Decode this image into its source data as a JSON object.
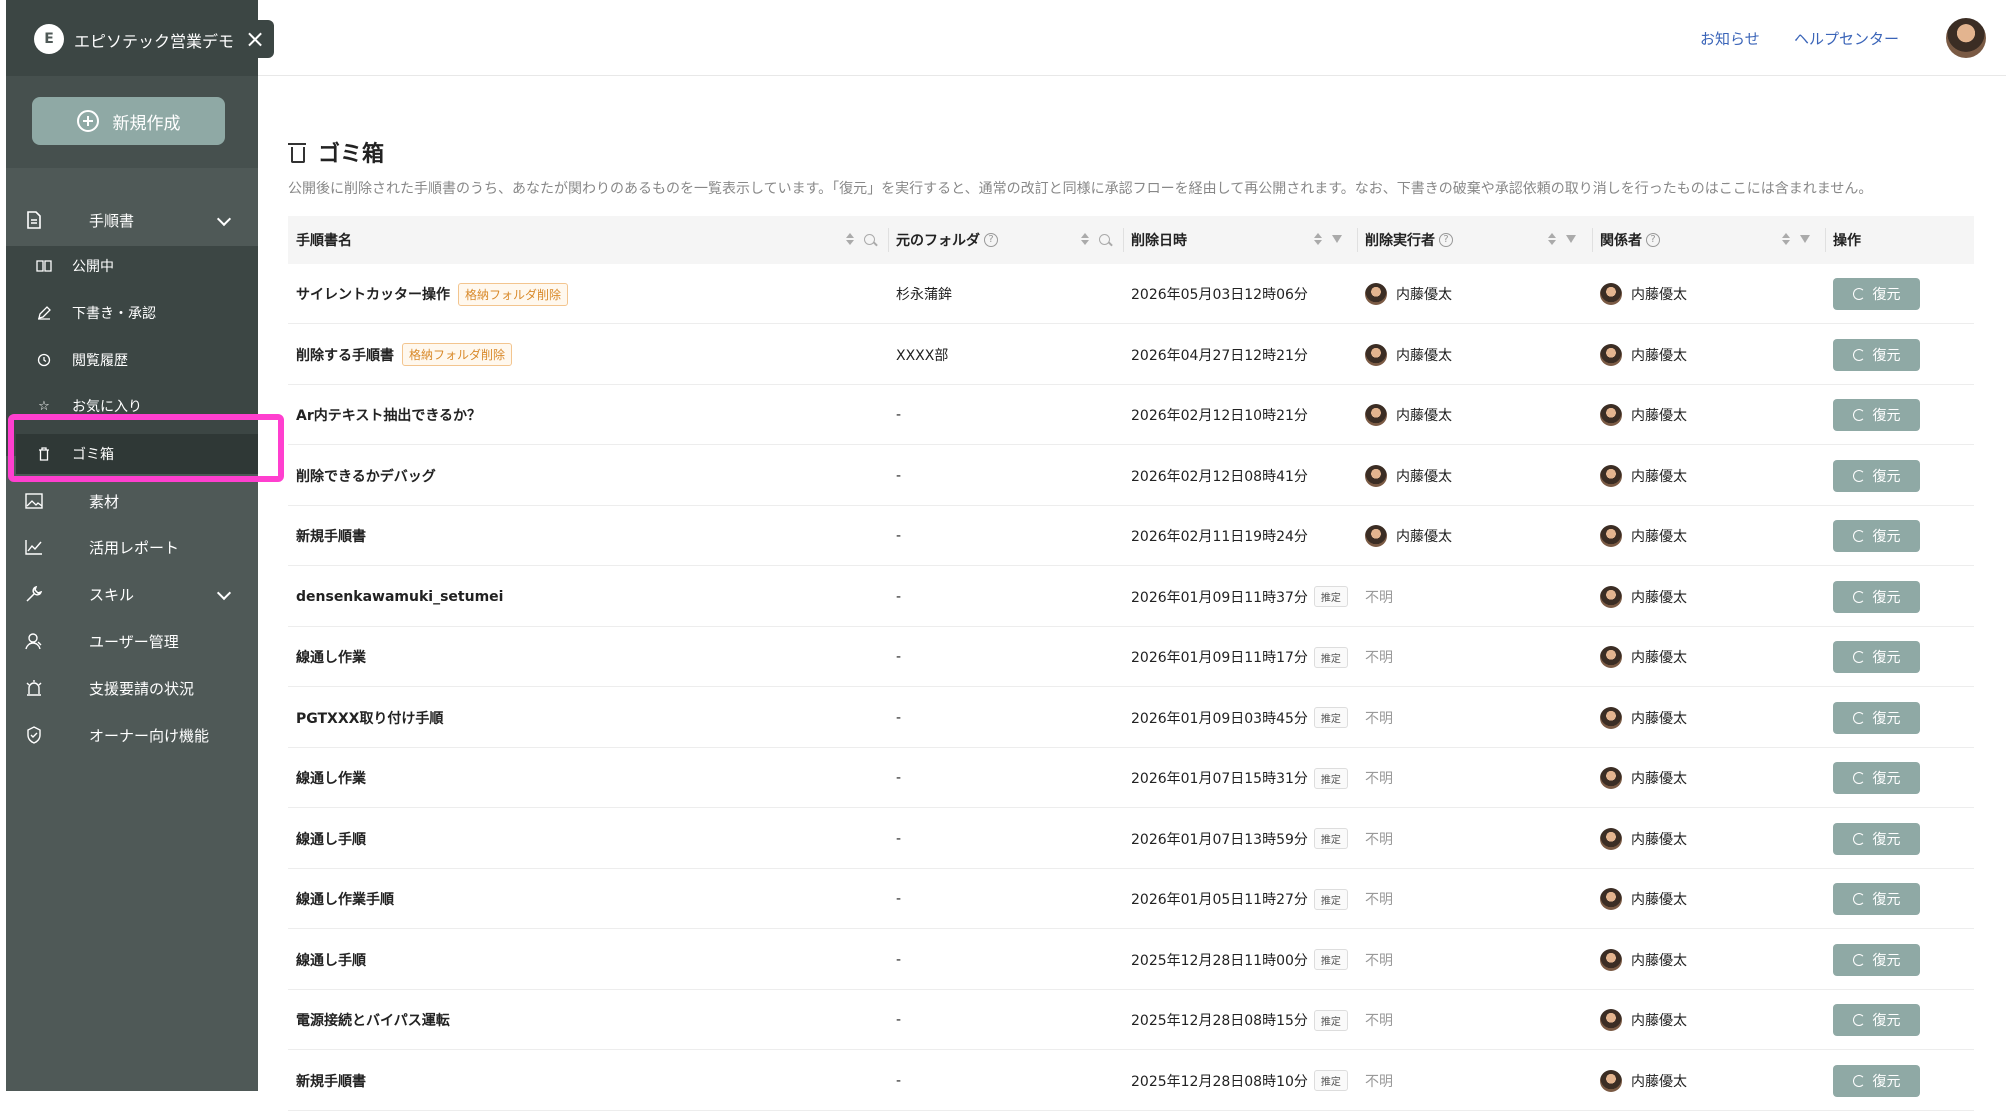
{
  "sidebar": {
    "org_name": "エピソテック営業デモ",
    "logo_text": "E",
    "new_button": "新規作成",
    "items": [
      {
        "label": "手順書",
        "icon": "document-icon"
      },
      {
        "label": "公開中",
        "icon": "book-icon"
      },
      {
        "label": "下書き・承認",
        "icon": "pencil-icon"
      },
      {
        "label": "閲覧履歴",
        "icon": "clock-icon"
      },
      {
        "label": "お気に入り",
        "icon": "star-icon"
      },
      {
        "label": "ゴミ箱",
        "icon": "trash-icon"
      },
      {
        "label": "素材",
        "icon": "image-icon"
      },
      {
        "label": "活用レポート",
        "icon": "chart-icon"
      },
      {
        "label": "スキル",
        "icon": "wrench-icon"
      },
      {
        "label": "ユーザー管理",
        "icon": "users-icon"
      },
      {
        "label": "支援要請の状況",
        "icon": "alert-icon"
      },
      {
        "label": "オーナー向け機能",
        "icon": "shield-icon"
      }
    ]
  },
  "topbar": {
    "news": "お知らせ",
    "help": "ヘルプセンター"
  },
  "page": {
    "title": "ゴミ箱",
    "description": "公開後に削除された手順書のうち、あなたが関わりのあるものを一覧表示しています。「復元」を実行すると、通常の改訂と同様に承認フローを経由して再公開されます。なお、下書きの破棄や承認依頼の取り消しを行ったものはここには含まれません。"
  },
  "table": {
    "headers": {
      "name": "手順書名",
      "folder": "元のフォルダ",
      "date": "削除日時",
      "executor": "削除実行者",
      "related": "関係者",
      "actions": "操作"
    },
    "help_mark": "?",
    "restore_label": "復元",
    "estimated_label": "推定",
    "rows": [
      {
        "name": "サイレントカッター操作",
        "tag": "格納フォルダ削除",
        "folder": "杉永蒲鉾",
        "date": "2026年05月03日12時06分",
        "estimated": false,
        "executor": "内藤優太",
        "related": "内藤優太"
      },
      {
        "name": "削除する手順書",
        "tag": "格納フォルダ削除",
        "folder": "XXXX部",
        "date": "2026年04月27日12時21分",
        "estimated": false,
        "executor": "内藤優太",
        "related": "内藤優太"
      },
      {
        "name": "Ar内テキスト抽出できるか？",
        "tag": "",
        "folder": "-",
        "date": "2026年02月12日10時21分",
        "estimated": false,
        "executor": "内藤優太",
        "related": "内藤優太"
      },
      {
        "name": "削除できるかデバッグ",
        "tag": "",
        "folder": "-",
        "date": "2026年02月12日08時41分",
        "estimated": false,
        "executor": "内藤優太",
        "related": "内藤優太"
      },
      {
        "name": "新規手順書",
        "tag": "",
        "folder": "-",
        "date": "2026年02月11日19時24分",
        "estimated": false,
        "executor": "内藤優太",
        "related": "内藤優太"
      },
      {
        "name": "densenkawamuki_setumei",
        "tag": "",
        "folder": "-",
        "date": "2026年01月09日11時37分",
        "estimated": true,
        "executor": "不明",
        "related": "内藤優太"
      },
      {
        "name": "線通し作業",
        "tag": "",
        "folder": "-",
        "date": "2026年01月09日11時17分",
        "estimated": true,
        "executor": "不明",
        "related": "内藤優太"
      },
      {
        "name": "PGTXXX取り付け手順",
        "tag": "",
        "folder": "-",
        "date": "2026年01月09日03時45分",
        "estimated": true,
        "executor": "不明",
        "related": "内藤優太"
      },
      {
        "name": "線通し作業",
        "tag": "",
        "folder": "-",
        "date": "2026年01月07日15時31分",
        "estimated": true,
        "executor": "不明",
        "related": "内藤優太"
      },
      {
        "name": "線通し手順",
        "tag": "",
        "folder": "-",
        "date": "2026年01月07日13時59分",
        "estimated": true,
        "executor": "不明",
        "related": "内藤優太"
      },
      {
        "name": "線通し作業手順",
        "tag": "",
        "folder": "-",
        "date": "2026年01月05日11時27分",
        "estimated": true,
        "executor": "不明",
        "related": "内藤優太"
      },
      {
        "name": "線通し手順",
        "tag": "",
        "folder": "-",
        "date": "2025年12月28日11時00分",
        "estimated": true,
        "executor": "不明",
        "related": "内藤優太"
      },
      {
        "name": "電源接続とバイパス運転",
        "tag": "",
        "folder": "-",
        "date": "2025年12月28日08時15分",
        "estimated": true,
        "executor": "不明",
        "related": "内藤優太"
      },
      {
        "name": "新規手順書",
        "tag": "",
        "folder": "-",
        "date": "2025年12月28日08時10分",
        "estimated": true,
        "executor": "不明",
        "related": "内藤優太"
      }
    ]
  }
}
